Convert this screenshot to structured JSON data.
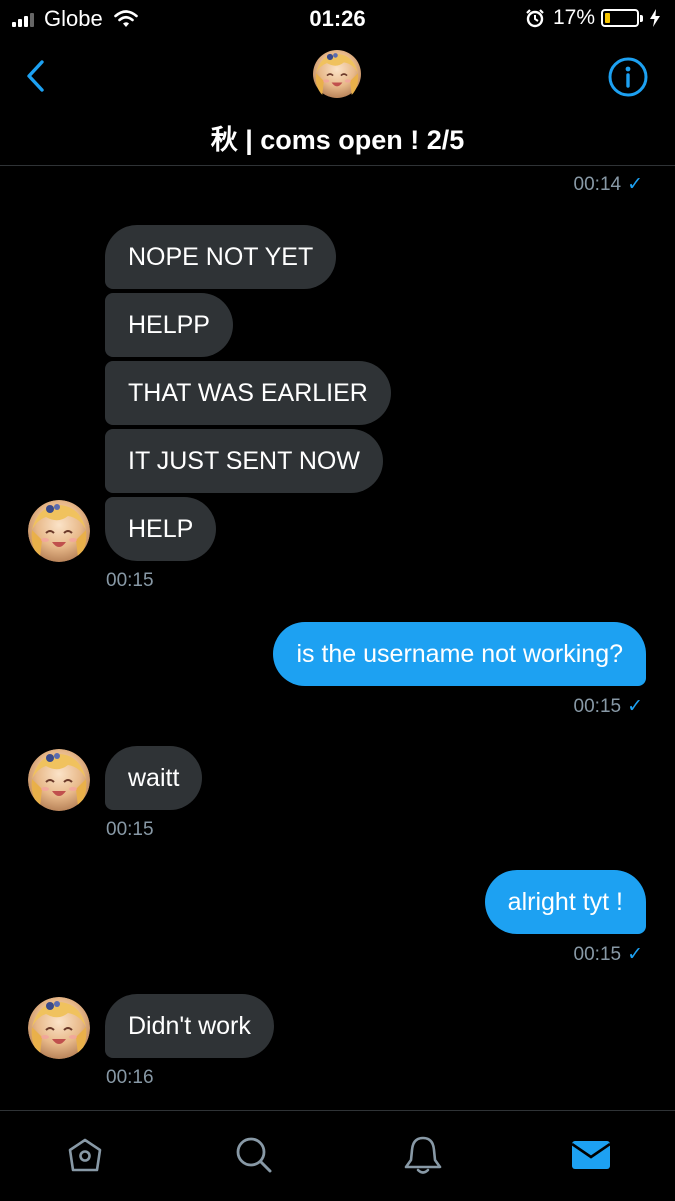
{
  "status_bar": {
    "carrier": "Globe",
    "time": "01:26",
    "battery_percent_label": "17%",
    "battery_level": 0.17,
    "icons": [
      "signal-icon",
      "wifi-icon",
      "alarm-icon",
      "battery-icon",
      "charging-bolt-icon"
    ]
  },
  "header": {
    "title": "秋 | coms open ! 2/5",
    "icons": [
      "back-icon",
      "avatar",
      "info-icon"
    ]
  },
  "messages": [
    {
      "direction": "out",
      "timestamp": "00:14",
      "read_check": "✓"
    },
    {
      "direction": "in",
      "text": "NOPE NOT YET"
    },
    {
      "direction": "in",
      "text": "HELPP"
    },
    {
      "direction": "in",
      "text": "THAT WAS EARLIER"
    },
    {
      "direction": "in",
      "text": "IT JUST SENT NOW"
    },
    {
      "direction": "in",
      "text": "HELP",
      "timestamp": "00:15"
    },
    {
      "direction": "out",
      "text": "is the username not working?",
      "timestamp": "00:15",
      "read_check": "✓"
    },
    {
      "direction": "in",
      "text": "waitt",
      "timestamp": "00:15"
    },
    {
      "direction": "out",
      "text": "alright tyt !",
      "timestamp": "00:15",
      "read_check": "✓"
    },
    {
      "direction": "in",
      "text": "Didn't work",
      "timestamp": "00:16"
    }
  ],
  "tab_bar": {
    "tabs": [
      "home-icon",
      "search-icon",
      "notifications-icon",
      "messages-icon"
    ],
    "active_tab": "messages-icon"
  },
  "colors": {
    "background": "#000000",
    "incoming_bubble": "#2f3336",
    "outgoing_bubble": "#1da1f2",
    "accent": "#1da1f2",
    "timestamp": "#8899a6",
    "battery_fill": "#f5c400"
  }
}
